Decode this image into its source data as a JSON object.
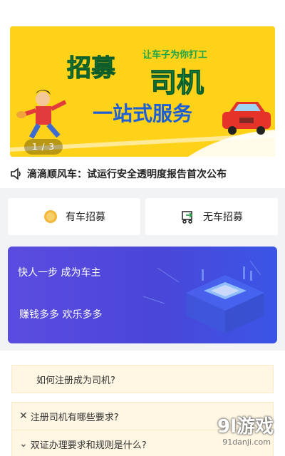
{
  "banner": {
    "tagline": "让车子为你打工",
    "headline_left": "招募",
    "headline_right": "司机",
    "subtitle": "一站式服务",
    "pager": "1 / 3",
    "colors": {
      "background": "#ffd21a",
      "headline": "#19a64a",
      "subtitle": "#1d5fd6"
    }
  },
  "notice": {
    "text": "滴滴顺风车：试运行安全透明度报告首次公布",
    "icon": "speaker-icon"
  },
  "actions": [
    {
      "label": "有车招募",
      "icon": "coin-icon"
    },
    {
      "label": "无车招募",
      "icon": "cart-icon"
    }
  ],
  "promo": {
    "line1": "快人一步   成为车主",
    "line2": "赚钱多多   欢乐多多",
    "colors": {
      "start": "#5b4ce0",
      "end": "#3b55e6"
    }
  },
  "faq": [
    {
      "text": "如何注册成为司机?"
    },
    {
      "text": "注册司机有哪些要求?"
    },
    {
      "text": "双证办理要求和规则是什么?"
    }
  ],
  "watermark": {
    "text": "9l游戏",
    "site": "91danji.com"
  }
}
